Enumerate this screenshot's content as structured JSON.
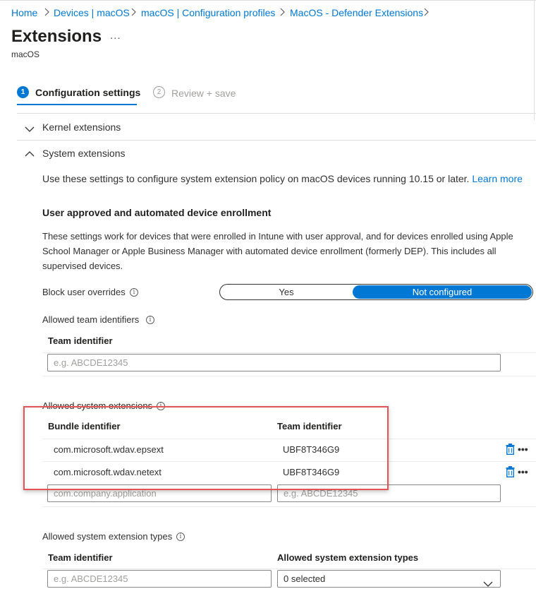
{
  "breadcrumb": [
    "Home",
    "Devices | macOS",
    "macOS | Configuration profiles",
    "MacOS - Defender Extensions"
  ],
  "page": {
    "title": "Extensions",
    "more": "...",
    "subtitle": "macOS"
  },
  "steps": [
    {
      "number": "1",
      "label": "Configuration settings",
      "active": true
    },
    {
      "number": "2",
      "label": "Review + save",
      "active": false
    }
  ],
  "sections": {
    "kernel": "Kernel extensions",
    "system": "System extensions"
  },
  "system_ext": {
    "description": "Use these settings to configure system extension policy on macOS devices running 10.15 or later.",
    "learn_more": "Learn more",
    "enrollment_heading": "User approved and automated device enrollment",
    "enrollment_text": "These settings work for devices that were enrolled in Intune with user approval, and for devices enrolled using Apple School Manager or Apple Business Manager with automated device enrollment (formerly DEP). This includes all supervised devices.",
    "block_overrides": {
      "label": "Block user overrides",
      "options": [
        "Yes",
        "Not configured"
      ],
      "selected": "Not configured"
    },
    "allowed_team_ids": {
      "label": "Allowed team identifiers",
      "column": "Team identifier",
      "placeholder": "e.g. ABCDE12345"
    },
    "allowed_system_extensions": {
      "label": "Allowed system extensions",
      "columns": [
        "Bundle identifier",
        "Team identifier"
      ],
      "rows": [
        {
          "bundle": "com.microsoft.wdav.epsext",
          "team": "UBF8T346G9"
        },
        {
          "bundle": "com.microsoft.wdav.netext",
          "team": "UBF8T346G9"
        }
      ],
      "bundle_placeholder": "com.company.application",
      "team_placeholder": "e.g. ABCDE12345",
      "row_more": "•••"
    },
    "allowed_extension_types": {
      "label": "Allowed system extension types",
      "columns": [
        "Team identifier",
        "Allowed system extension types"
      ],
      "team_placeholder": "e.g. ABCDE12345",
      "types_value": "0 selected"
    }
  },
  "colors": {
    "accent": "#0078d4",
    "highlight": "#e55454"
  }
}
